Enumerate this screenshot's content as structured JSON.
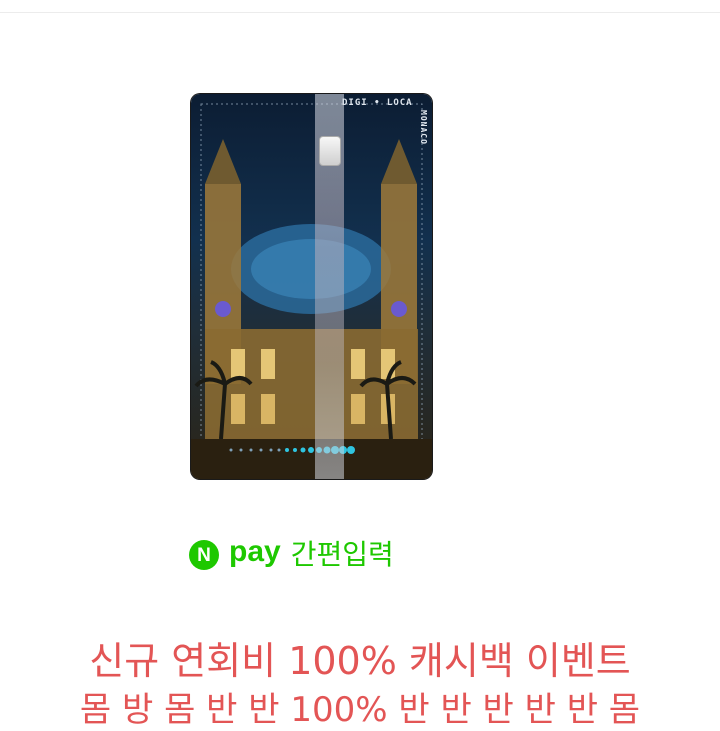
{
  "card": {
    "brand": "DIGI • LOCA",
    "brand_sub": "MONACO"
  },
  "npay": {
    "icon_letter": "N",
    "pay_text": "pay",
    "label": "간편입력",
    "color": "#1ec800"
  },
  "event": {
    "title": "신규 연회비 100% 캐시백 이벤트",
    "subtitle": "몸 방 몸 반 반 100% 반 반 반 반 반 몸",
    "color": "#e35555"
  }
}
